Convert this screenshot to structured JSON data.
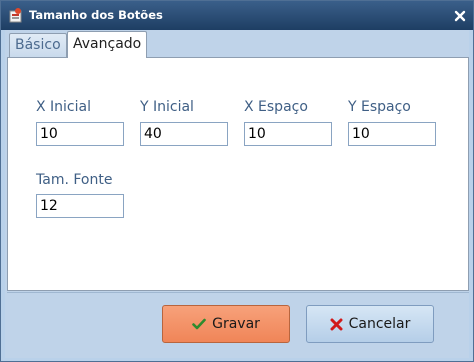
{
  "window": {
    "title": "Tamanho dos Botões",
    "close_icon": "close-icon"
  },
  "tabs": [
    {
      "label": "Básico",
      "selected": false
    },
    {
      "label": "Avançado",
      "selected": true
    }
  ],
  "fields": {
    "x_inicial": {
      "label": "X Inicial",
      "value": "10"
    },
    "y_inicial": {
      "label": "Y Inicial",
      "value": "40"
    },
    "x_espaco": {
      "label": "X Espaço",
      "value": "10"
    },
    "y_espaco": {
      "label": "Y Espaço",
      "value": "10"
    },
    "tam_fonte": {
      "label": "Tam. Fonte",
      "value": "12"
    }
  },
  "buttons": {
    "gravar": {
      "label": "Gravar",
      "icon": "checkmark-icon",
      "color": "#f08558"
    },
    "cancelar": {
      "label": "Cancelar",
      "icon": "x-icon",
      "color": "#c8dcf0"
    }
  }
}
